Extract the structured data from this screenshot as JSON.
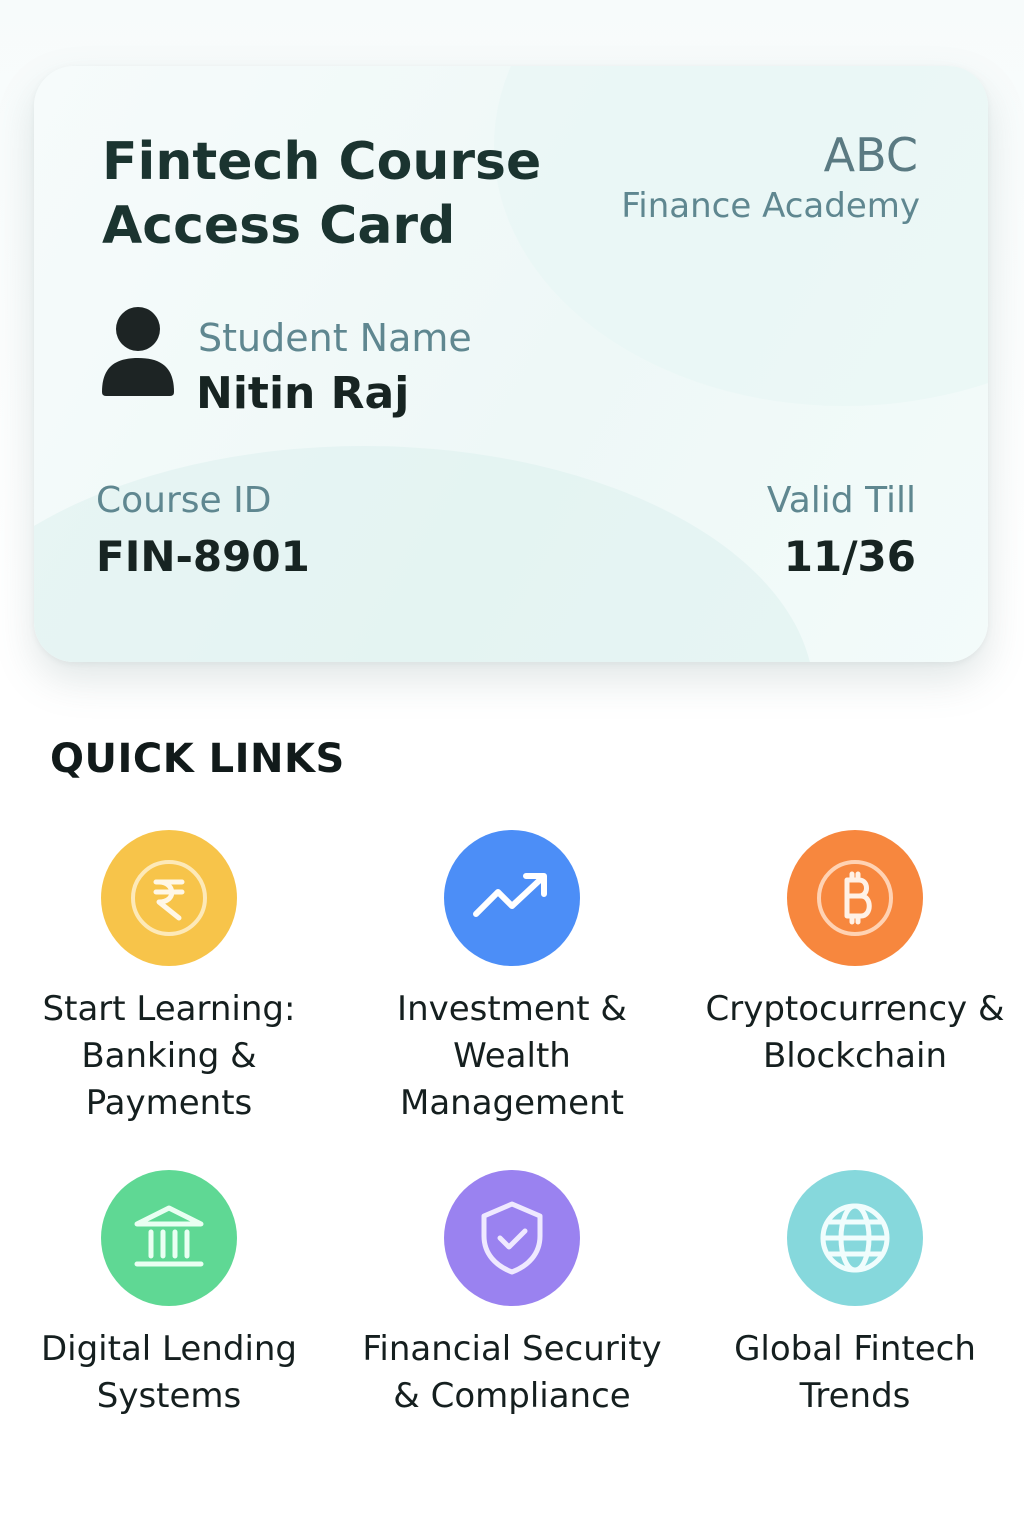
{
  "card": {
    "title": "Fintech Course Access Card",
    "org_abbr": "ABC",
    "org_name": "Finance Academy",
    "student_label": "Student Name",
    "student_name": "Nitin Raj",
    "course_id_label": "Course ID",
    "course_id": "FIN-8901",
    "valid_label": "Valid Till",
    "valid_till": "11/36"
  },
  "quick_links": {
    "heading": "QUICK LINKS",
    "items": [
      {
        "label": "Start Learning: Banking & Payments",
        "icon": "rupee-icon",
        "color": "#f7c44a"
      },
      {
        "label": "Investment & Wealth Management",
        "icon": "trend-up-icon",
        "color": "#4c8ef7"
      },
      {
        "label": "Cryptocurrency & Blockchain",
        "icon": "bitcoin-icon",
        "color": "#f7873e"
      },
      {
        "label": "Digital Lending Systems",
        "icon": "bank-icon",
        "color": "#5fd894"
      },
      {
        "label": "Financial Security & Compliance",
        "icon": "shield-check-icon",
        "color": "#9a82f0"
      },
      {
        "label": "Global Fintech Trends",
        "icon": "globe-icon",
        "color": "#86d8dc"
      }
    ]
  }
}
